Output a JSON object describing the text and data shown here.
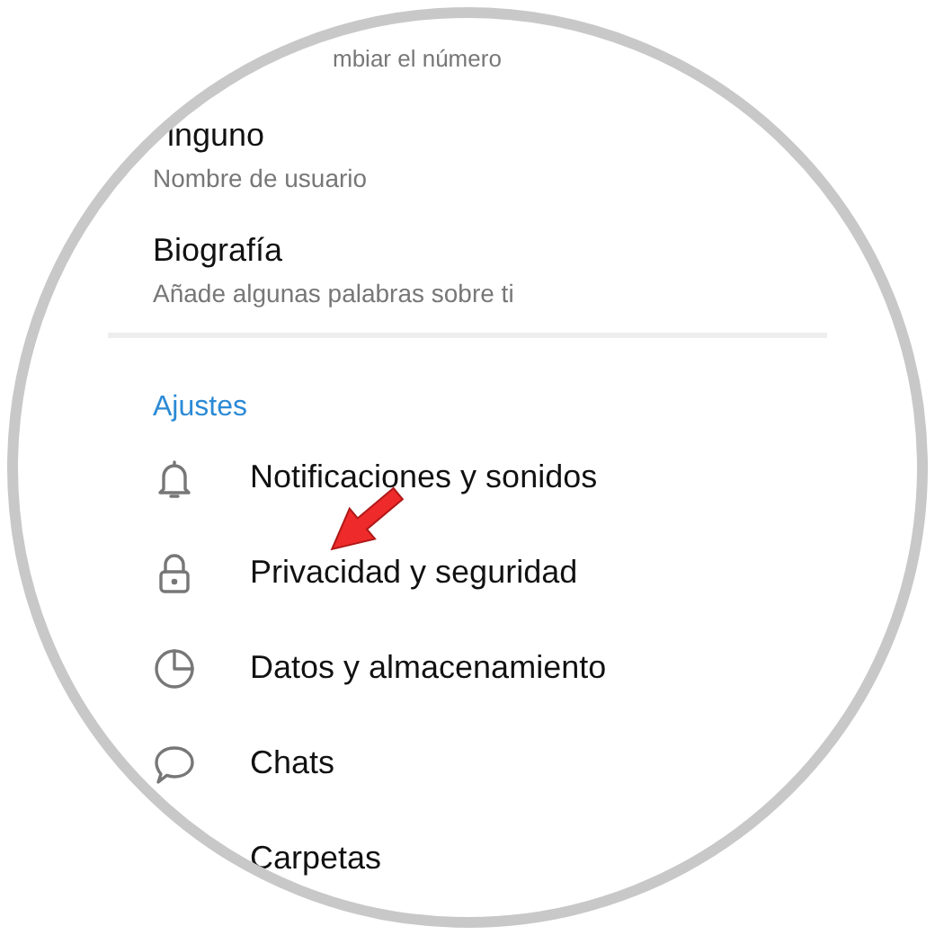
{
  "phone_hint": "mbiar el número",
  "profile_fields": [
    {
      "value": "inguno",
      "label": "Nombre de usuario"
    },
    {
      "value": "Biografía",
      "label": "Añade algunas palabras sobre ti"
    }
  ],
  "section_title": "Ajustes",
  "settings": [
    {
      "kind": "bell",
      "label": "Notificaciones y sonidos"
    },
    {
      "kind": "lock",
      "label": "Privacidad y seguridad"
    },
    {
      "kind": "pie",
      "label": "Datos y almacenamiento"
    },
    {
      "kind": "chat",
      "label": "Chats"
    },
    {
      "kind": "plain",
      "label": "Carpetas"
    }
  ]
}
